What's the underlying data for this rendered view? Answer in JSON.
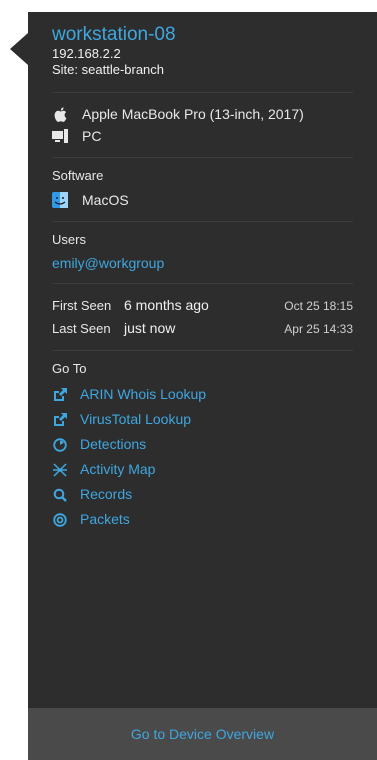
{
  "device": {
    "hostname": "workstation-08",
    "ip": "192.168.2.2",
    "site_label": "Site:",
    "site_value": "seattle-branch"
  },
  "hardware": {
    "model": "Apple MacBook Pro (13-inch, 2017)",
    "type": "PC"
  },
  "software": {
    "label": "Software",
    "os": "MacOS"
  },
  "users": {
    "label": "Users",
    "items": [
      "emily@workgroup"
    ]
  },
  "seen": {
    "first_label": "First Seen",
    "first_value": "6 months ago",
    "first_date": "Oct 25 18:15",
    "last_label": "Last Seen",
    "last_value": "just now",
    "last_date": "Apr 25 14:33"
  },
  "goto": {
    "label": "Go To",
    "items": [
      {
        "label": "ARIN Whois Lookup",
        "icon": "external-link-icon"
      },
      {
        "label": "VirusTotal Lookup",
        "icon": "external-link-icon"
      },
      {
        "label": "Detections",
        "icon": "detections-icon"
      },
      {
        "label": "Activity Map",
        "icon": "activity-map-icon"
      },
      {
        "label": "Records",
        "icon": "search-icon"
      },
      {
        "label": "Packets",
        "icon": "packets-icon"
      }
    ]
  },
  "footer": {
    "label": "Go to Device Overview"
  },
  "colors": {
    "panel_bg": "#2d2d2d",
    "accent": "#3fa7e0",
    "footer_bg": "#4a4a4a"
  }
}
